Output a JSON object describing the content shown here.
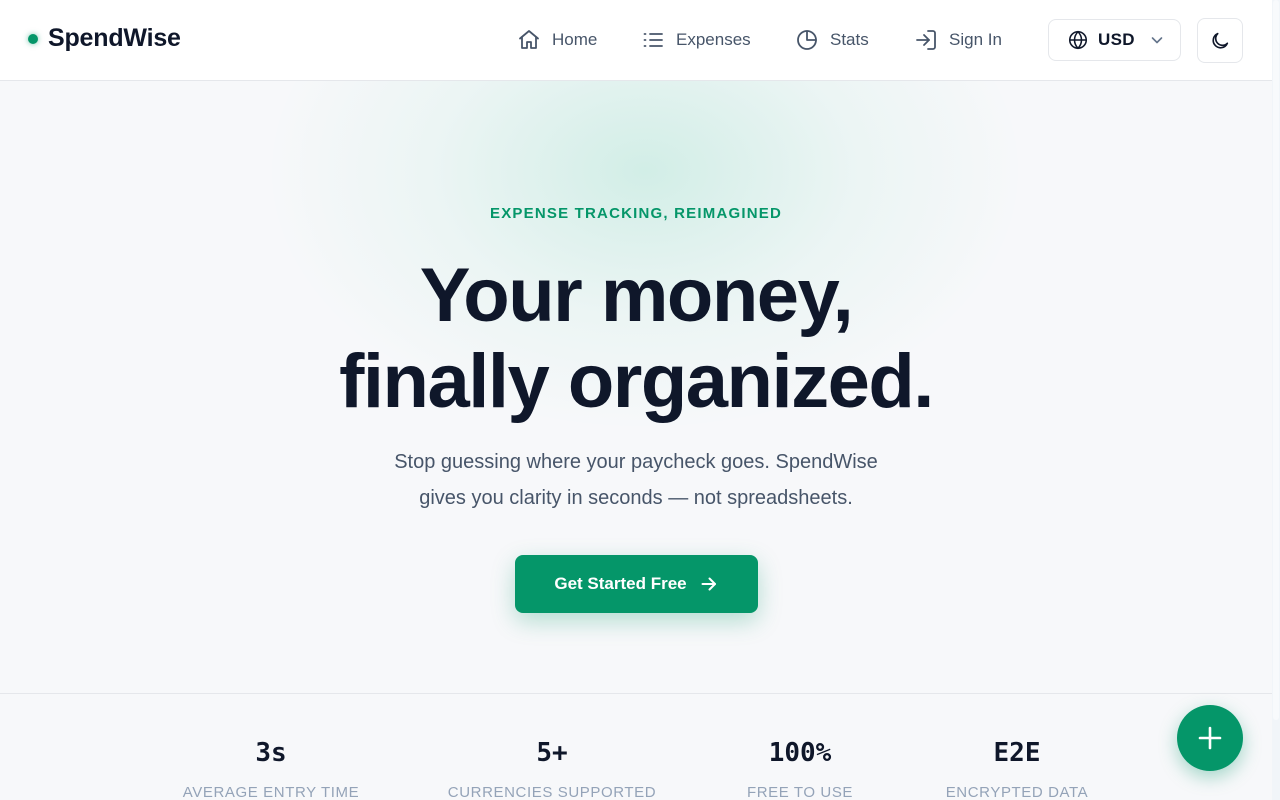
{
  "brand": {
    "name": "SpendWise",
    "accent": "#059669"
  },
  "nav": {
    "items": [
      {
        "label": "Home",
        "icon": "home-icon"
      },
      {
        "label": "Expenses",
        "icon": "list-icon"
      },
      {
        "label": "Stats",
        "icon": "pie-chart-icon"
      },
      {
        "label": "Sign In",
        "icon": "sign-in-icon"
      }
    ],
    "currency": {
      "value": "USD",
      "icon": "globe-icon"
    },
    "theme_toggle_icon": "moon-icon"
  },
  "hero": {
    "eyebrow": "EXPENSE TRACKING, REIMAGINED",
    "headline_line1": "Your money,",
    "headline_line2": "finally organized.",
    "sub_line1": "Stop guessing where your paycheck goes. SpendWise",
    "sub_line2": "gives you clarity in seconds — not spreadsheets.",
    "cta_label": "Get Started Free"
  },
  "stats": [
    {
      "value": "3s",
      "label": "AVERAGE ENTRY TIME"
    },
    {
      "value": "5+",
      "label": "CURRENCIES SUPPORTED"
    },
    {
      "value": "100%",
      "label": "FREE TO USE"
    },
    {
      "value": "E2E",
      "label": "ENCRYPTED DATA"
    }
  ],
  "fab": {
    "icon": "plus-icon"
  }
}
